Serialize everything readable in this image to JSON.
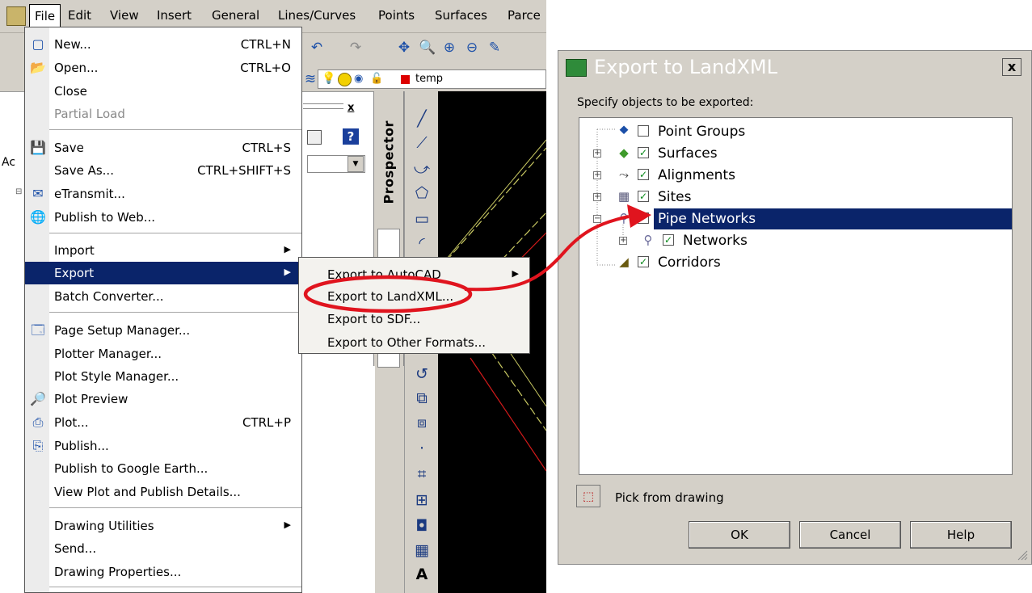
{
  "menubar": {
    "items": [
      "File",
      "Edit",
      "View",
      "Insert",
      "General",
      "Lines/Curves",
      "Points",
      "Surfaces",
      "Parce"
    ]
  },
  "toolbar": {
    "layer_name": "temp"
  },
  "toolspace": {
    "tab_label": "Prospector",
    "partial_text": "Ac"
  },
  "file_menu": {
    "items": [
      {
        "label": "New...",
        "shortcut": "CTRL+N",
        "icon": "new-document-icon"
      },
      {
        "label": "Open...",
        "shortcut": "CTRL+O",
        "icon": "open-folder-icon"
      },
      {
        "label": "Close",
        "shortcut": ""
      },
      {
        "label": "Partial Load",
        "shortcut": "",
        "disabled": true
      },
      {
        "label": "Save",
        "shortcut": "CTRL+S",
        "icon": "save-icon"
      },
      {
        "label": "Save As...",
        "shortcut": "CTRL+SHIFT+S"
      },
      {
        "label": "eTransmit...",
        "shortcut": "",
        "icon": "etransmit-icon"
      },
      {
        "label": "Publish to Web...",
        "shortcut": "",
        "icon": "publish-web-icon"
      },
      {
        "label": "Import",
        "shortcut": "",
        "submenu": true
      },
      {
        "label": "Export",
        "shortcut": "",
        "submenu": true,
        "highlighted": true
      },
      {
        "label": "Batch Converter...",
        "shortcut": ""
      },
      {
        "label": "Page Setup Manager...",
        "shortcut": "",
        "icon": "page-setup-icon"
      },
      {
        "label": "Plotter Manager...",
        "shortcut": ""
      },
      {
        "label": "Plot Style Manager...",
        "shortcut": ""
      },
      {
        "label": "Plot Preview",
        "shortcut": "",
        "icon": "plot-preview-icon"
      },
      {
        "label": "Plot...",
        "shortcut": "CTRL+P",
        "icon": "plot-icon"
      },
      {
        "label": "Publish...",
        "shortcut": "",
        "icon": "publish-icon"
      },
      {
        "label": "Publish to Google Earth...",
        "shortcut": ""
      },
      {
        "label": "View Plot and Publish Details...",
        "shortcut": ""
      },
      {
        "label": "Drawing Utilities",
        "shortcut": "",
        "submenu": true
      },
      {
        "label": "Send...",
        "shortcut": ""
      },
      {
        "label": "Drawing Properties...",
        "shortcut": ""
      }
    ]
  },
  "export_submenu": {
    "items": [
      {
        "label": "Export to AutoCAD",
        "submenu": true
      },
      {
        "label": "Export to LandXML..."
      },
      {
        "label": "Export to SDF..."
      },
      {
        "label": "Export to Other Formats..."
      }
    ],
    "circled_item": "Export to LandXML...",
    "circle_color": "#e0141e"
  },
  "dialog": {
    "title": "Export to LandXML",
    "close_label": "x",
    "prompt": "Specify objects to be exported:",
    "tree": [
      {
        "label": "Point Groups",
        "checked": false,
        "expandable": false,
        "icon": "point-groups-icon"
      },
      {
        "label": "Surfaces",
        "checked": true,
        "expandable": true,
        "icon": "surfaces-icon"
      },
      {
        "label": "Alignments",
        "checked": true,
        "expandable": true,
        "icon": "alignments-icon"
      },
      {
        "label": "Sites",
        "checked": true,
        "expandable": true,
        "icon": "sites-icon"
      },
      {
        "label": "Pipe Networks",
        "checked": true,
        "expandable": true,
        "expanded": true,
        "selected": true,
        "icon": "pipe-networks-icon"
      },
      {
        "label": "Networks",
        "checked": true,
        "expandable": true,
        "child": true,
        "icon": "networks-icon"
      },
      {
        "label": "Corridors",
        "checked": true,
        "expandable": false,
        "icon": "corridors-icon"
      }
    ],
    "pick_label": "Pick from drawing",
    "buttons": {
      "ok": "OK",
      "cancel": "Cancel",
      "help": "Help"
    }
  },
  "colors": {
    "menu_highlight": "#0a246a",
    "annotation_red": "#e0141e",
    "dialog_face": "#d4d0c8"
  }
}
